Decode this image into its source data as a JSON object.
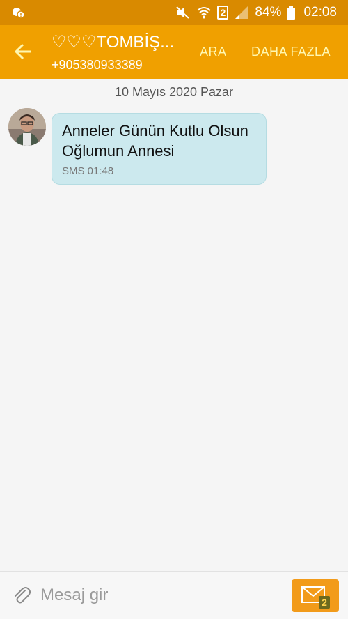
{
  "status_bar": {
    "battery": "84%",
    "time": "02:08",
    "sim_slot": "2"
  },
  "header": {
    "contact_name": "♡♡♡TOMBİŞ...",
    "contact_number": "+905380933389",
    "call_label": "ARA",
    "more_label": "DAHA FAZLA"
  },
  "conversation": {
    "date_divider": "10 Mayıs 2020 Pazar",
    "messages": [
      {
        "text": "Anneler Günün Kutlu Olsun Oğlumun Annesi",
        "meta": "SMS 01:48"
      }
    ]
  },
  "composer": {
    "placeholder": "Mesaj gir",
    "send_sim": "2"
  },
  "colors": {
    "status_bar": "#d98a00",
    "app_bar": "#f0a000",
    "action_text": "#fff7b0",
    "bubble": "#cce9ee",
    "send_button": "#f29b1a"
  }
}
